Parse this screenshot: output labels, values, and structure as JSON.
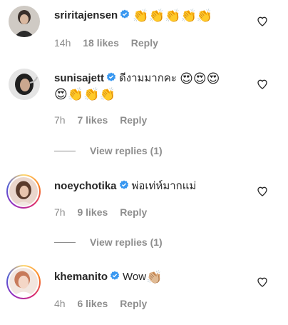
{
  "comments": [
    {
      "username": "sriritajensen",
      "text": "",
      "emojis": "👏👏👏👏👏",
      "time": "14h",
      "likes": "18 likes",
      "reply": "Reply"
    },
    {
      "username": "sunisajett",
      "text": "ดีงามมากคะ",
      "emojis": "😍😍😍",
      "emojis_line2": "😍👏👏👏",
      "time": "7h",
      "likes": "7 likes",
      "reply": "Reply",
      "view_replies": "View replies (1)"
    },
    {
      "username": "noeychotika",
      "text": "พ่อเท่ห์มากแม่",
      "time": "7h",
      "likes": "9 likes",
      "reply": "Reply",
      "view_replies": "View replies (1)"
    },
    {
      "username": "khemanito",
      "text": "Wow",
      "emojis": "👏🏼",
      "time": "4h",
      "likes": "6 likes",
      "reply": "Reply"
    }
  ],
  "icons": {
    "verified": "verified-badge-icon",
    "heart": "heart-outline-icon"
  },
  "colors": {
    "verified_blue": "#3897f0",
    "muted": "#8e8e8e",
    "text": "#262626"
  }
}
